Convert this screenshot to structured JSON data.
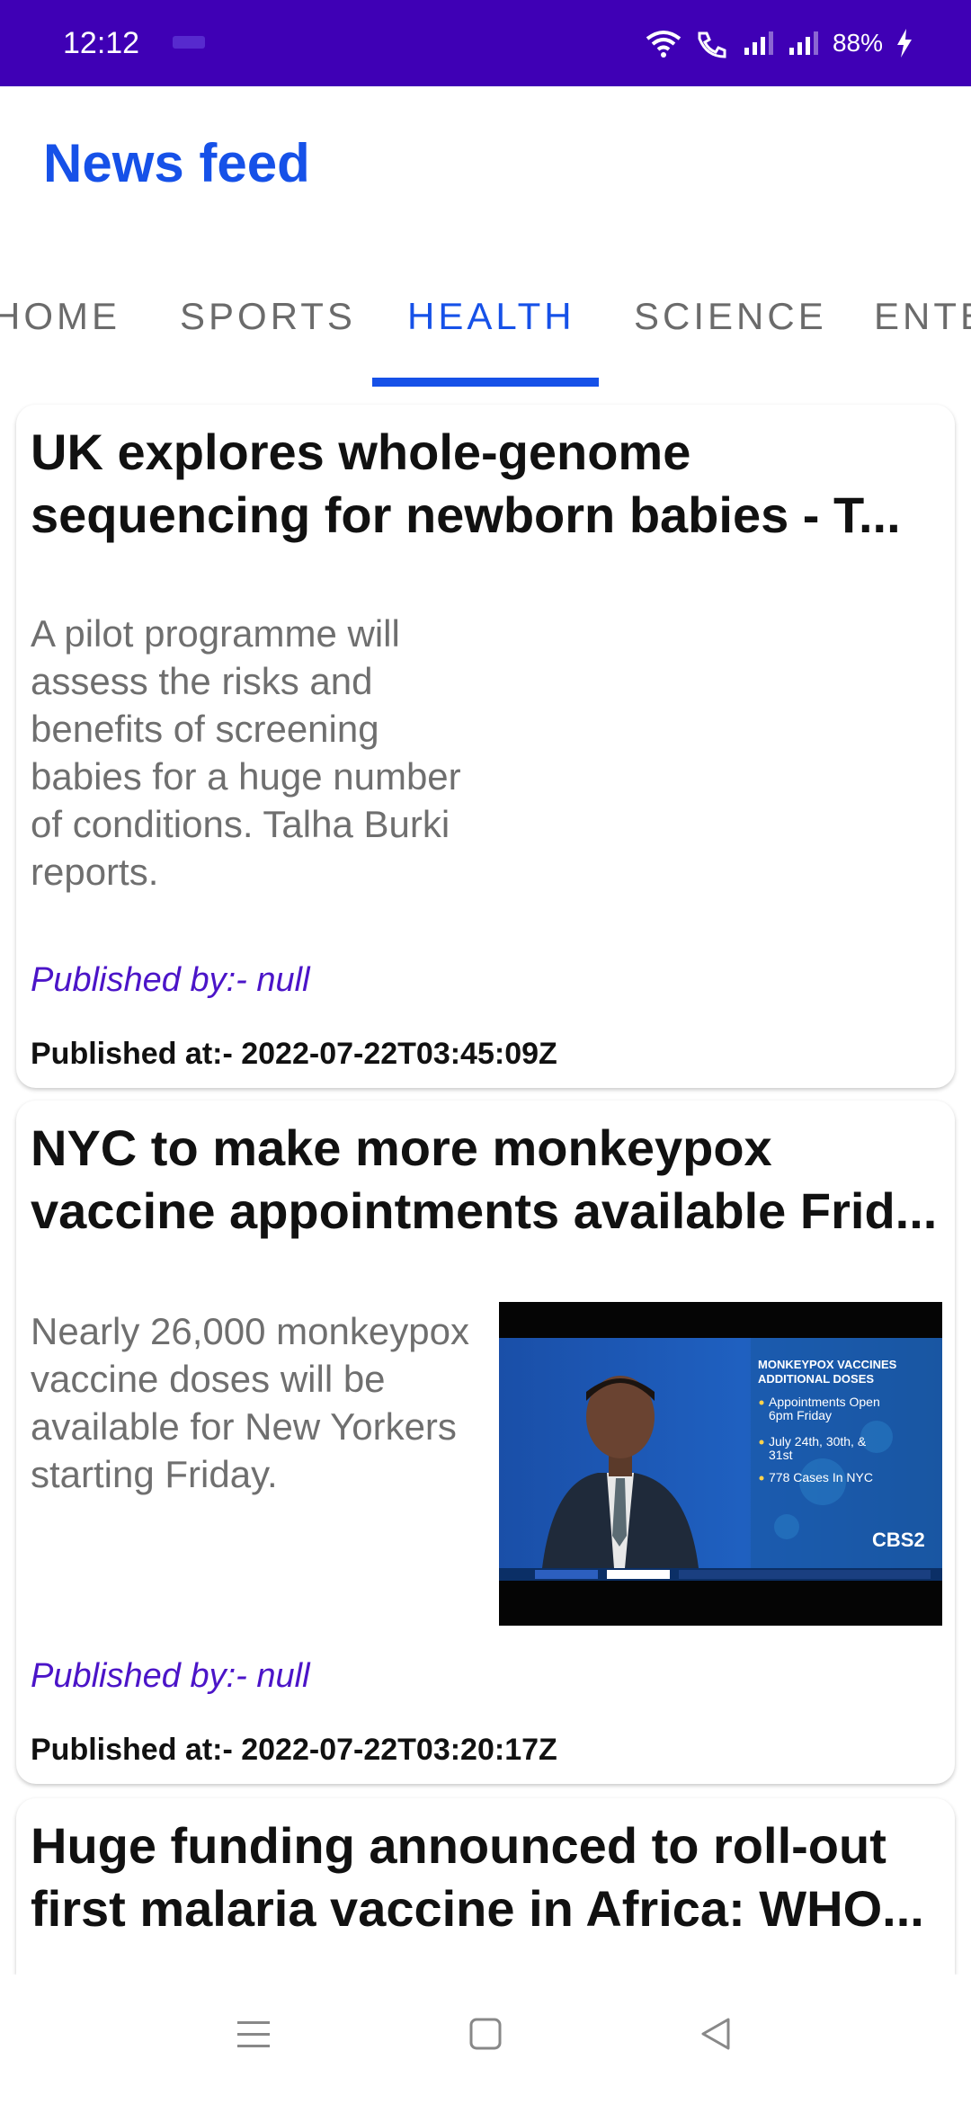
{
  "status_bar": {
    "time": "12:12",
    "battery": "88%"
  },
  "app": {
    "title": "News feed"
  },
  "tabs": [
    {
      "label": "HOME",
      "active": false
    },
    {
      "label": "SPORTS",
      "active": false
    },
    {
      "label": "HEALTH",
      "active": true
    },
    {
      "label": "SCIENCE",
      "active": false
    },
    {
      "label": "ENTE",
      "active": false
    }
  ],
  "articles": [
    {
      "title": "UK explores whole-genome sequencing for newborn babies - T...",
      "description": "A pilot programme will assess the risks and benefits of screening babies for a huge number of conditions. Talha Burki reports.",
      "published_by": "Published by:- null",
      "published_at": "Published at:- 2022-07-22T03:45:09Z"
    },
    {
      "title": "NYC to make more monkeypox vaccine appointments available Frid...",
      "description": "Nearly 26,000 monkeypox vaccine doses will be available for New Yorkers starting Friday.",
      "published_by": "Published by:- null",
      "published_at": "Published at:- 2022-07-22T03:20:17Z",
      "thumbnail": {
        "heading": "MONKEYPOX VACCINES ADDITIONAL DOSES",
        "bullets": [
          "Appointments Open 6pm Friday",
          "July 24th, 30th, & 31st",
          "778 Cases In NYC"
        ]
      }
    },
    {
      "title": "Huge funding announced to roll-out first malaria vaccine in Africa: WHO..."
    }
  ],
  "colors": {
    "status_bar": "#3f00b5",
    "accent": "#1651e8",
    "publisher": "#4b14c8"
  }
}
